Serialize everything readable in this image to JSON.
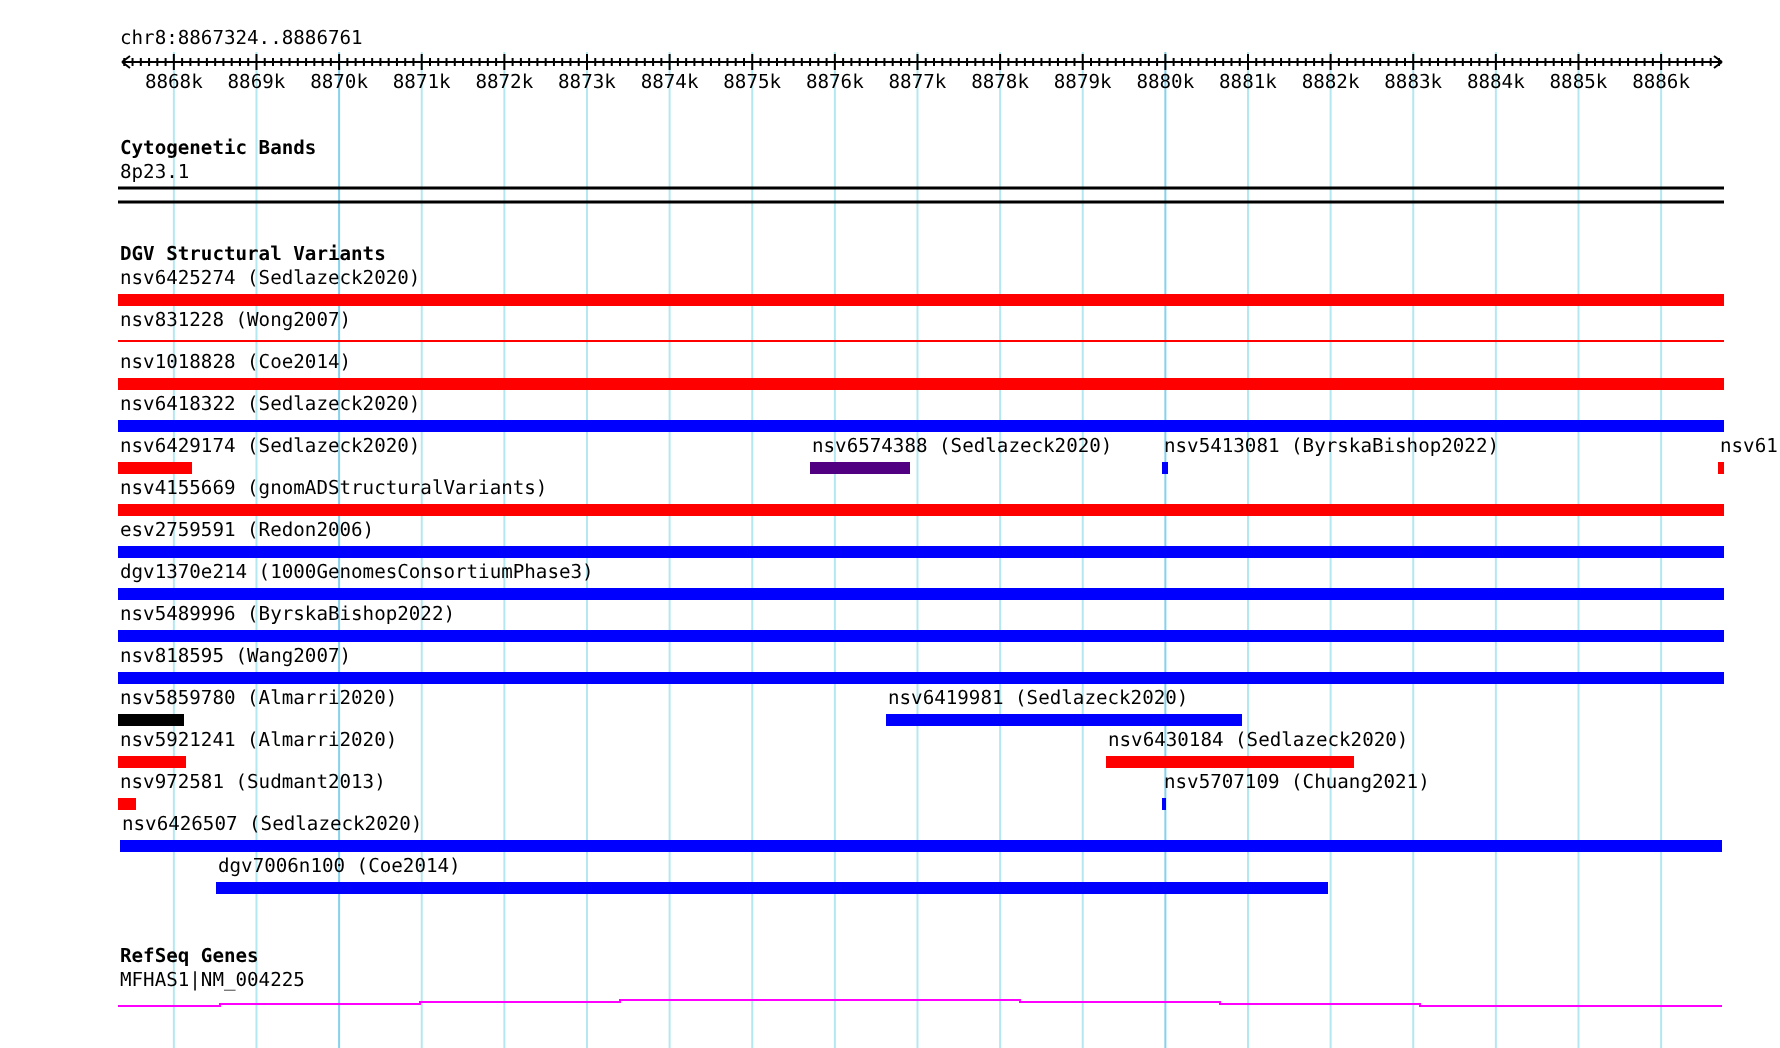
{
  "location": "chr8:8867324..8886761",
  "ruler": {
    "ticks": [
      "8868k",
      "8869k",
      "8870k",
      "8871k",
      "8872k",
      "8873k",
      "8874k",
      "8875k",
      "8876k",
      "8877k",
      "8878k",
      "8879k",
      "8880k",
      "8881k",
      "8882k",
      "8883k",
      "8884k",
      "8885k",
      "8886k"
    ]
  },
  "cytoband": {
    "title": "Cytogenetic Bands",
    "band": "8p23.1"
  },
  "dgv": {
    "title": "DGV Structural Variants",
    "rows": [
      {
        "features": [
          {
            "label": "nsv6425274 (Sedlazeck2020)",
            "color": "#ff0000",
            "kind": "bar"
          }
        ]
      },
      {
        "features": [
          {
            "label": "nsv831228 (Wong2007)",
            "color": "#ff0000",
            "kind": "line"
          }
        ]
      },
      {
        "features": [
          {
            "label": "nsv1018828 (Coe2014)",
            "color": "#ff0000",
            "kind": "bar"
          }
        ]
      },
      {
        "features": [
          {
            "label": "nsv6418322 (Sedlazeck2020)",
            "color": "#0000ff",
            "kind": "bar"
          }
        ]
      },
      {
        "features": [
          {
            "label": "nsv6429174 (Sedlazeck2020)",
            "color": "#ff0000",
            "kind": "bar"
          },
          {
            "label": "nsv6574388 (Sedlazeck2020)",
            "color": "#500080",
            "kind": "bar"
          },
          {
            "label": "nsv5413081 (ByrskaBishop2022)",
            "color": "#0000ff",
            "kind": "bar"
          },
          {
            "label": "nsv61",
            "color": "#ff0000",
            "kind": "bar"
          }
        ]
      },
      {
        "features": [
          {
            "label": "nsv4155669 (gnomADStructuralVariants)",
            "color": "#ff0000",
            "kind": "bar"
          }
        ]
      },
      {
        "features": [
          {
            "label": "esv2759591 (Redon2006)",
            "color": "#0000ff",
            "kind": "bar"
          }
        ]
      },
      {
        "features": [
          {
            "label": "dgv1370e214 (1000GenomesConsortiumPhase3)",
            "color": "#0000ff",
            "kind": "bar"
          }
        ]
      },
      {
        "features": [
          {
            "label": "nsv5489996 (ByrskaBishop2022)",
            "color": "#0000ff",
            "kind": "bar"
          }
        ]
      },
      {
        "features": [
          {
            "label": "nsv818595 (Wang2007)",
            "color": "#0000ff",
            "kind": "bar"
          }
        ]
      },
      {
        "features": [
          {
            "label": "nsv5859780 (Almarri2020)",
            "color": "#000000",
            "kind": "bar"
          },
          {
            "label": "nsv6419981 (Sedlazeck2020)",
            "color": "#0000ff",
            "kind": "bar"
          }
        ]
      },
      {
        "features": [
          {
            "label": "nsv5921241 (Almarri2020)",
            "color": "#ff0000",
            "kind": "bar"
          },
          {
            "label": "nsv6430184 (Sedlazeck2020)",
            "color": "#ff0000",
            "kind": "bar"
          }
        ]
      },
      {
        "features": [
          {
            "label": "nsv972581 (Sudmant2013)",
            "color": "#ff0000",
            "kind": "bar"
          },
          {
            "label": "nsv5707109 (Chuang2021)",
            "color": "#0000ff",
            "kind": "bar"
          }
        ]
      },
      {
        "features": [
          {
            "label": "nsv6426507 (Sedlazeck2020)",
            "color": "#0000ff",
            "kind": "bar"
          }
        ]
      },
      {
        "features": [
          {
            "label": "dgv7006n100 (Coe2014)",
            "color": "#0000ff",
            "kind": "bar"
          }
        ]
      }
    ]
  },
  "refseq": {
    "title": "RefSeq Genes",
    "gene": "MFHAS1|NM_004225"
  }
}
